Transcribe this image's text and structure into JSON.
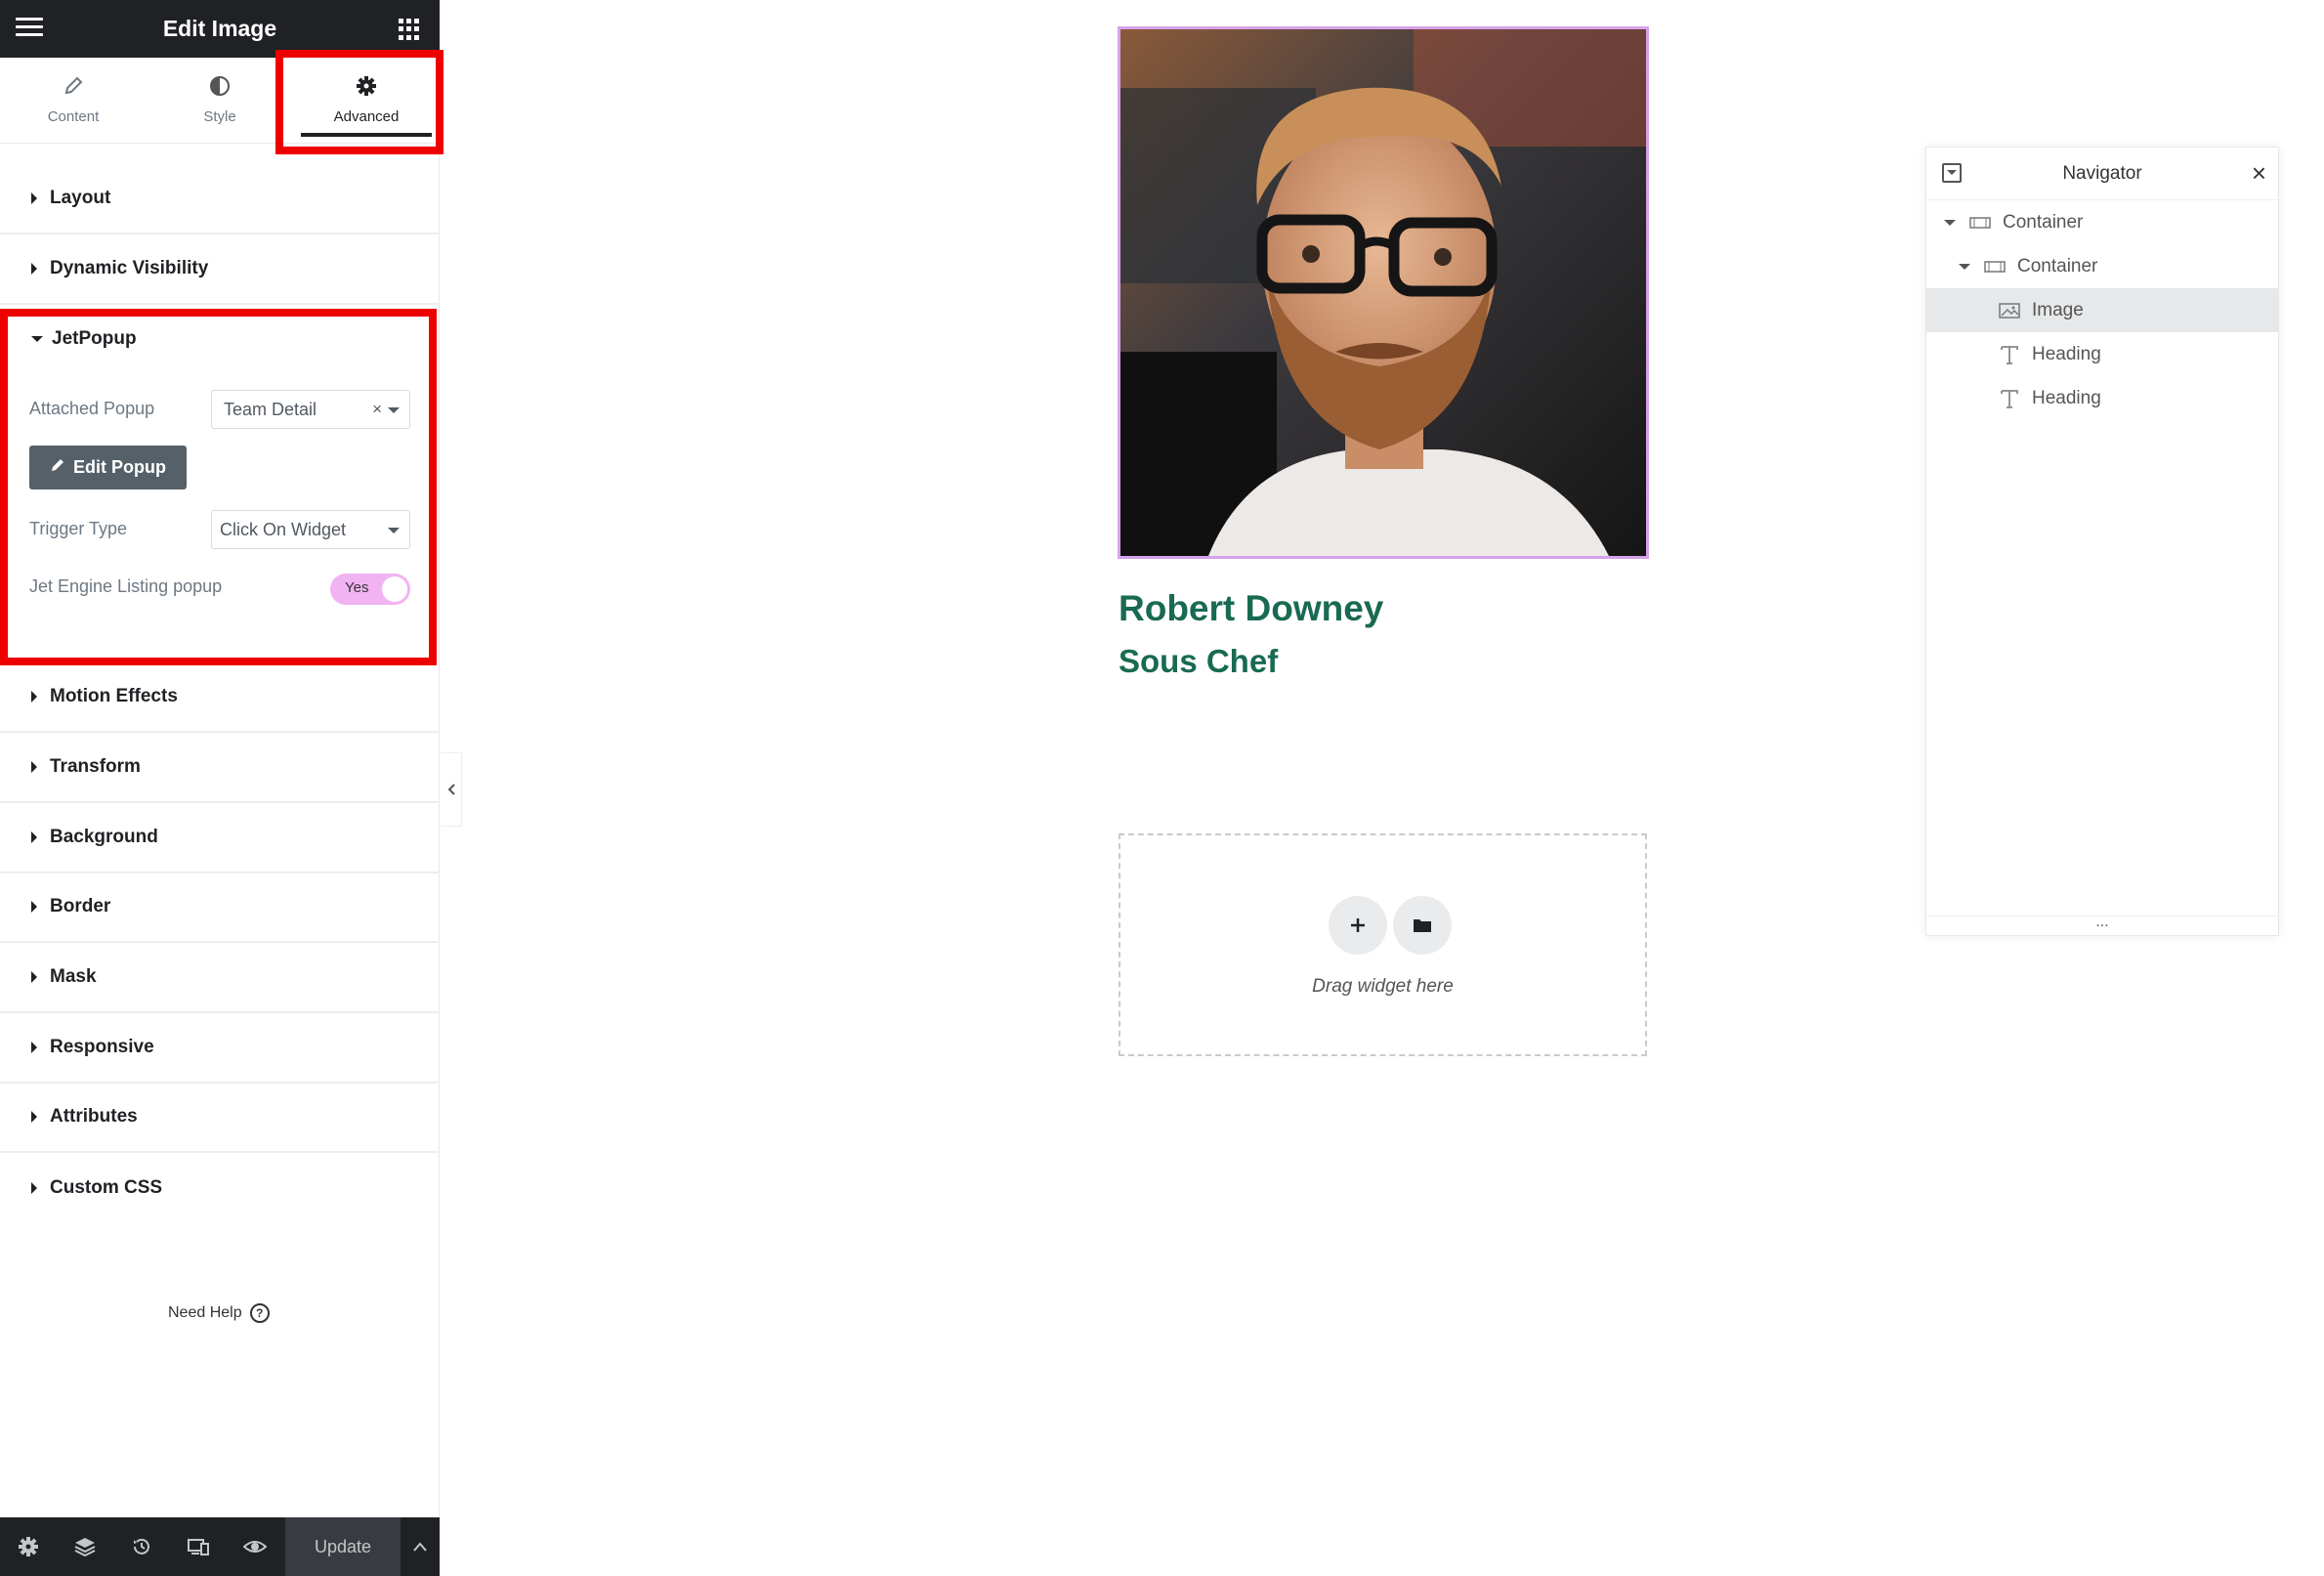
{
  "panel": {
    "title": "Edit Image",
    "tabs": [
      {
        "label": "Content",
        "icon": "pencil-icon"
      },
      {
        "label": "Style",
        "icon": "half-circle-icon"
      },
      {
        "label": "Advanced",
        "icon": "gear-icon",
        "active": true
      }
    ],
    "sections_top": [
      "Layout",
      "Dynamic Visibility"
    ],
    "jetpopup": {
      "title": "JetPopup",
      "attached_popup_label": "Attached Popup",
      "attached_popup_value": "Team Detail",
      "edit_popup_label": "Edit Popup",
      "trigger_type_label": "Trigger Type",
      "trigger_type_value": "Click On Widget",
      "listing_popup_label": "Jet Engine Listing popup",
      "listing_popup_value": "Yes"
    },
    "sections_bottom": [
      "Motion Effects",
      "Transform",
      "Background",
      "Border",
      "Mask",
      "Responsive",
      "Attributes",
      "Custom CSS"
    ],
    "need_help": "Need Help",
    "footer": {
      "icons": [
        "settings-icon",
        "layers-icon",
        "history-icon",
        "responsive-icon",
        "preview-icon"
      ],
      "update_label": "Update"
    }
  },
  "canvas": {
    "name": "Robert Downey",
    "role": "Sous Chef",
    "drag_text": "Drag widget here",
    "accent_color": "#196a52",
    "selection_color": "#d6a2e8"
  },
  "navigator": {
    "title": "Navigator",
    "close": "×",
    "more": "...",
    "items": [
      {
        "label": "Container",
        "icon": "container-icon"
      },
      {
        "label": "Container",
        "icon": "container-icon"
      },
      {
        "label": "Image",
        "icon": "image-icon",
        "selected": true
      },
      {
        "label": "Heading",
        "icon": "heading-icon"
      },
      {
        "label": "Heading",
        "icon": "heading-icon"
      }
    ]
  },
  "highlight_color": "#ee0000"
}
